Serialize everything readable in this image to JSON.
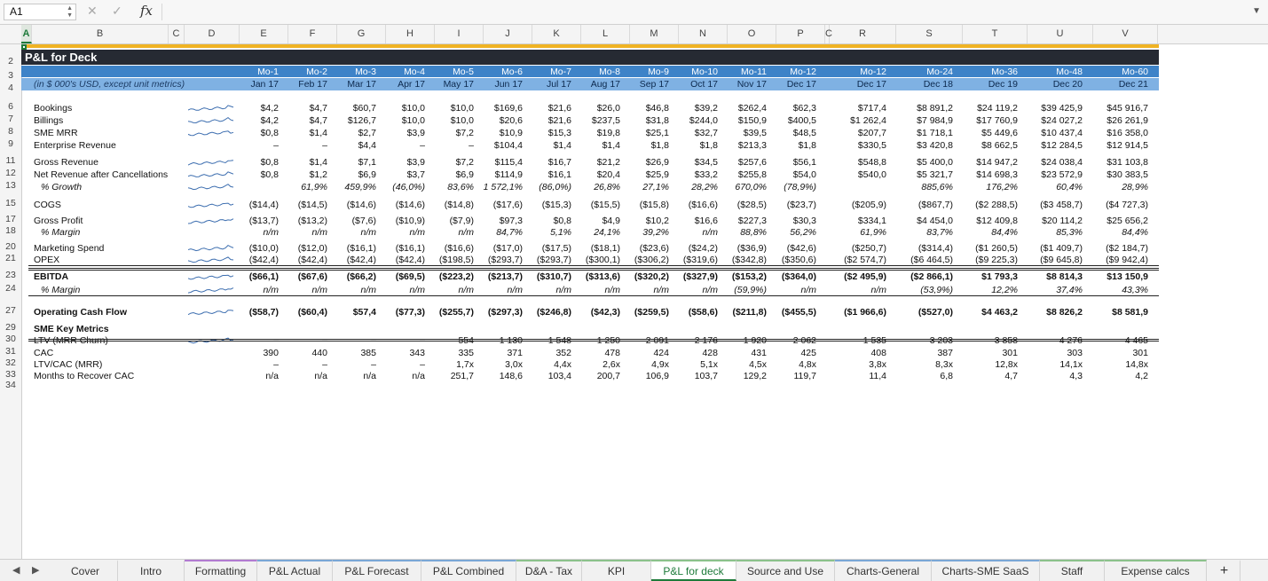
{
  "formula_bar": {
    "cell_ref": "A1",
    "fx_label": "fx",
    "formula": ""
  },
  "columns": [
    "A",
    "B",
    "C",
    "D",
    "E",
    "F",
    "G",
    "H",
    "I",
    "J",
    "K",
    "L",
    "M",
    "N",
    "O",
    "P",
    "Q",
    "R",
    "S",
    "T",
    "U",
    "V"
  ],
  "column_q_partial": "C",
  "sheet_title": "P&L for Deck",
  "unit_note": "(in $ 000's USD, except unit metrics)",
  "months": [
    "Mo-1",
    "Mo-2",
    "Mo-3",
    "Mo-4",
    "Mo-5",
    "Mo-6",
    "Mo-7",
    "Mo-8",
    "Mo-9",
    "Mo-10",
    "Mo-11",
    "Mo-12",
    "Mo-12",
    "Mo-24",
    "Mo-36",
    "Mo-48",
    "Mo-60"
  ],
  "dates": [
    "Jan 17",
    "Feb 17",
    "Mar 17",
    "Apr 17",
    "May 17",
    "Jun 17",
    "Jul 17",
    "Aug 17",
    "Sep 17",
    "Oct 17",
    "Nov 17",
    "Dec 17",
    "Dec 17",
    "Dec 18",
    "Dec 19",
    "Dec 20",
    "Dec 21"
  ],
  "rows": [
    {
      "n": "6",
      "label": "Bookings",
      "spark": true,
      "values": [
        "$4,2",
        "$4,7",
        "$60,7",
        "$10,0",
        "$10,0",
        "$169,6",
        "$21,6",
        "$26,0",
        "$46,8",
        "$39,2",
        "$262,4",
        "$62,3",
        "$717,4",
        "$8 891,2",
        "$24 119,2",
        "$39 425,9",
        "$45 916,7"
      ]
    },
    {
      "n": "7",
      "label": "Billings",
      "spark": true,
      "values": [
        "$4,2",
        "$4,7",
        "$126,7",
        "$10,0",
        "$10,0",
        "$20,6",
        "$21,6",
        "$237,5",
        "$31,8",
        "$244,0",
        "$150,9",
        "$400,5",
        "$1 262,4",
        "$7 984,9",
        "$17 760,9",
        "$24 027,2",
        "$26 261,9"
      ]
    },
    {
      "n": "8",
      "label": "SME MRR",
      "spark": true,
      "values": [
        "$0,8",
        "$1,4",
        "$2,7",
        "$3,9",
        "$7,2",
        "$10,9",
        "$15,3",
        "$19,8",
        "$25,1",
        "$32,7",
        "$39,5",
        "$48,5",
        "$207,7",
        "$1 718,1",
        "$5 449,6",
        "$10 437,4",
        "$16 358,0"
      ]
    },
    {
      "n": "9",
      "label": "Enterprise Revenue",
      "spark": false,
      "values": [
        "–",
        "–",
        "$4,4",
        "–",
        "–",
        "$104,4",
        "$1,4",
        "$1,4",
        "$1,8",
        "$1,8",
        "$213,3",
        "$1,8",
        "$330,5",
        "$3 420,8",
        "$8 662,5",
        "$12 284,5",
        "$12 914,5"
      ]
    },
    {
      "n": "11",
      "label": "Gross Revenue",
      "spark": true,
      "values": [
        "$0,8",
        "$1,4",
        "$7,1",
        "$3,9",
        "$7,2",
        "$115,4",
        "$16,7",
        "$21,2",
        "$26,9",
        "$34,5",
        "$257,6",
        "$56,1",
        "$548,8",
        "$5 400,0",
        "$14 947,2",
        "$24 038,4",
        "$31 103,8"
      ]
    },
    {
      "n": "12",
      "label": "Net Revenue after Cancellations",
      "spark": true,
      "values": [
        "$0,8",
        "$1,2",
        "$6,9",
        "$3,7",
        "$6,9",
        "$114,9",
        "$16,1",
        "$20,4",
        "$25,9",
        "$33,2",
        "$255,8",
        "$54,0",
        "$540,0",
        "$5 321,7",
        "$14 698,3",
        "$23 572,9",
        "$30 383,5"
      ]
    },
    {
      "n": "13",
      "label": "% Growth",
      "spark": true,
      "indent": true,
      "italic": true,
      "values": [
        "",
        "61,9%",
        "459,9%",
        "(46,0%)",
        "83,6%",
        "1 572,1%",
        "(86,0%)",
        "26,8%",
        "27,1%",
        "28,2%",
        "670,0%",
        "(78,9%)",
        "",
        "885,6%",
        "176,2%",
        "60,4%",
        "28,9%"
      ]
    },
    {
      "n": "15",
      "label": "COGS",
      "spark": true,
      "values": [
        "($14,4)",
        "($14,5)",
        "($14,6)",
        "($14,6)",
        "($14,8)",
        "($17,6)",
        "($15,3)",
        "($15,5)",
        "($15,8)",
        "($16,6)",
        "($28,5)",
        "($23,7)",
        "($205,9)",
        "($867,7)",
        "($2 288,5)",
        "($3 458,7)",
        "($4 727,3)"
      ]
    },
    {
      "n": "17",
      "label": "Gross Profit",
      "spark": true,
      "values": [
        "($13,7)",
        "($13,2)",
        "($7,6)",
        "($10,9)",
        "($7,9)",
        "$97,3",
        "$0,8",
        "$4,9",
        "$10,2",
        "$16,6",
        "$227,3",
        "$30,3",
        "$334,1",
        "$4 454,0",
        "$12 409,8",
        "$20 114,2",
        "$25 656,2"
      ]
    },
    {
      "n": "18",
      "label": "% Margin",
      "spark": false,
      "indent": true,
      "italic": true,
      "values": [
        "n/m",
        "n/m",
        "n/m",
        "n/m",
        "n/m",
        "84,7%",
        "5,1%",
        "24,1%",
        "39,2%",
        "n/m",
        "88,8%",
        "56,2%",
        "61,9%",
        "83,7%",
        "84,4%",
        "85,3%",
        "84,4%"
      ]
    },
    {
      "n": "20",
      "label": "Marketing Spend",
      "spark": true,
      "values": [
        "($10,0)",
        "($12,0)",
        "($16,1)",
        "($16,1)",
        "($16,6)",
        "($17,0)",
        "($17,5)",
        "($18,1)",
        "($23,6)",
        "($24,2)",
        "($36,9)",
        "($42,6)",
        "($250,7)",
        "($314,4)",
        "($1 260,5)",
        "($1 409,7)",
        "($2 184,7)"
      ]
    },
    {
      "n": "21",
      "label": "OPEX",
      "spark": true,
      "values": [
        "($42,4)",
        "($42,4)",
        "($42,4)",
        "($42,4)",
        "($198,5)",
        "($293,7)",
        "($293,7)",
        "($300,1)",
        "($306,2)",
        "($319,6)",
        "($342,8)",
        "($350,6)",
        "($2 574,7)",
        "($6 464,5)",
        "($9 225,3)",
        "($9 645,8)",
        "($9 942,4)"
      ]
    },
    {
      "n": "23",
      "label": "EBITDA",
      "spark": true,
      "bold": true,
      "values": [
        "($66,1)",
        "($67,6)",
        "($66,2)",
        "($69,5)",
        "($223,2)",
        "($213,7)",
        "($310,7)",
        "($313,6)",
        "($320,2)",
        "($327,9)",
        "($153,2)",
        "($364,0)",
        "($2 495,9)",
        "($2 866,1)",
        "$1 793,3",
        "$8 814,3",
        "$13 150,9"
      ]
    },
    {
      "n": "24",
      "label": "% Margin",
      "spark": true,
      "indent": true,
      "italic": true,
      "values": [
        "n/m",
        "n/m",
        "n/m",
        "n/m",
        "n/m",
        "n/m",
        "n/m",
        "n/m",
        "n/m",
        "n/m",
        "(59,9%)",
        "n/m",
        "n/m",
        "(53,9%)",
        "12,2%",
        "37,4%",
        "43,3%"
      ]
    },
    {
      "n": "27",
      "label": "Operating Cash Flow",
      "spark": true,
      "bold": true,
      "values": [
        "($58,7)",
        "($60,4)",
        "$57,4",
        "($77,3)",
        "($255,7)",
        "($297,3)",
        "($246,8)",
        "($42,3)",
        "($259,5)",
        "($58,6)",
        "($211,8)",
        "($455,5)",
        "($1 966,6)",
        "($527,0)",
        "$4 463,2",
        "$8 826,2",
        "$8 581,9"
      ]
    },
    {
      "n": "29",
      "label": "SME Key Metrics",
      "spark": false,
      "bold": true,
      "values": []
    },
    {
      "n": "30",
      "label": "LTV (MRR Churn)",
      "spark": true,
      "values": [
        "–",
        "–",
        "–",
        "–",
        "554",
        "1 130",
        "1 548",
        "1 250",
        "2 091",
        "2 176",
        "1 920",
        "2 062",
        "1 535",
        "3 203",
        "3 858",
        "4 276",
        "4 465"
      ]
    },
    {
      "n": "31",
      "label": "CAC",
      "spark": false,
      "values": [
        "390",
        "440",
        "385",
        "343",
        "335",
        "371",
        "352",
        "478",
        "424",
        "428",
        "431",
        "425",
        "408",
        "387",
        "301",
        "303",
        "301"
      ]
    },
    {
      "n": "32",
      "label": "LTV/CAC (MRR)",
      "spark": false,
      "values": [
        "–",
        "–",
        "–",
        "–",
        "1,7x",
        "3,0x",
        "4,4x",
        "2,6x",
        "4,9x",
        "5,1x",
        "4,5x",
        "4,8x",
        "3,8x",
        "8,3x",
        "12,8x",
        "14,1x",
        "14,8x"
      ]
    },
    {
      "n": "33",
      "label": "Months to Recover CAC",
      "spark": false,
      "values": [
        "n/a",
        "n/a",
        "n/a",
        "n/a",
        "251,7",
        "148,6",
        "103,4",
        "200,7",
        "106,9",
        "103,7",
        "129,2",
        "119,7",
        "11,4",
        "6,8",
        "4,7",
        "4,3",
        "4,2"
      ]
    }
  ],
  "row_numbers": [
    "2",
    "3",
    "4",
    "6",
    "7",
    "8",
    "9",
    "11",
    "12",
    "13",
    "15",
    "17",
    "18",
    "20",
    "21",
    "23",
    "24",
    "27",
    "29",
    "30",
    "31",
    "32",
    "33",
    "34"
  ],
  "tabs": [
    {
      "label": "Cover",
      "accent": "#f1f1f1"
    },
    {
      "label": "Intro",
      "accent": "#f1f1f1"
    },
    {
      "label": "Formatting",
      "accent": "#b27bd1"
    },
    {
      "label": "P&L Actual",
      "accent": "#7aa7d6"
    },
    {
      "label": "P&L Forecast",
      "accent": "#7aa7d6"
    },
    {
      "label": "P&L Combined",
      "accent": "#7aa7d6"
    },
    {
      "label": "D&A - Tax",
      "accent": "#8bc28b"
    },
    {
      "label": "KPI",
      "accent": "#8bc28b"
    },
    {
      "label": "P&L for deck",
      "accent": "#8bc28b",
      "active": true
    },
    {
      "label": "Source and Use",
      "accent": "#8bc28b"
    },
    {
      "label": "Charts-General",
      "accent": "#7aa7d6"
    },
    {
      "label": "Charts-SME SaaS",
      "accent": "#7aa7d6"
    },
    {
      "label": "Staff",
      "accent": "#8bc28b"
    },
    {
      "label": "Expense calcs",
      "accent": "#8bc28b"
    }
  ],
  "add_sheet": "+",
  "colors": {
    "accent_green": "#1e7a3a",
    "banner": "#262a33",
    "month_bar": "#3e83c8",
    "date_bar": "#7fb1e3",
    "gold": "#f0b323"
  }
}
